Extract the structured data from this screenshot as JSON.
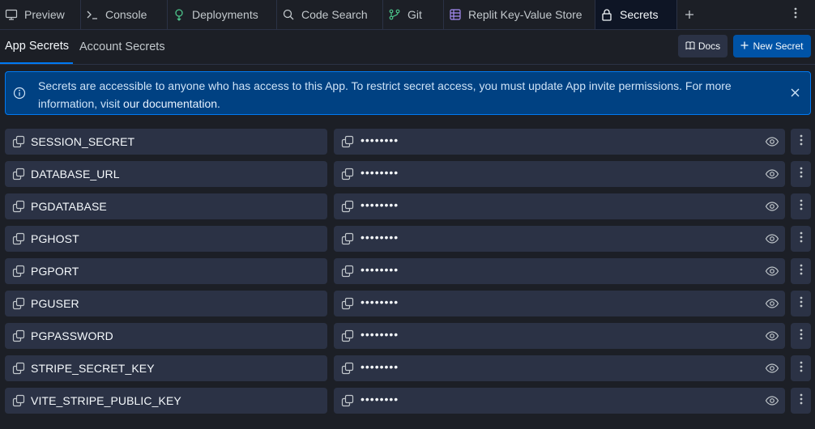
{
  "tabs": [
    {
      "label": "Preview",
      "icon": "monitor-icon"
    },
    {
      "label": "Console",
      "icon": "terminal-icon"
    },
    {
      "label": "Deployments",
      "icon": "deployments-icon"
    },
    {
      "label": "Code Search",
      "icon": "search-icon"
    },
    {
      "label": "Git",
      "icon": "git-icon"
    },
    {
      "label": "Replit Key-Value Store",
      "icon": "database-icon"
    },
    {
      "label": "Secrets",
      "icon": "lock-icon",
      "active": true
    }
  ],
  "subtabs": {
    "app_secrets": "App Secrets",
    "account_secrets": "Account Secrets"
  },
  "toolbar": {
    "docs_label": "Docs",
    "new_secret_label": "New Secret"
  },
  "banner": {
    "text": "Secrets are accessible to anyone who has access to this App. To restrict secret access, you must update App invite permissions. For more information, visit ",
    "link": "our documentation",
    "suffix": "."
  },
  "secrets": [
    {
      "key": "SESSION_SECRET",
      "value": "••••••••"
    },
    {
      "key": "DATABASE_URL",
      "value": "••••••••"
    },
    {
      "key": "PGDATABASE",
      "value": "••••••••"
    },
    {
      "key": "PGHOST",
      "value": "••••••••"
    },
    {
      "key": "PGPORT",
      "value": "••••••••"
    },
    {
      "key": "PGUSER",
      "value": "••••••••"
    },
    {
      "key": "PGPASSWORD",
      "value": "••••••••"
    },
    {
      "key": "STRIPE_SECRET_KEY",
      "value": "••••••••"
    },
    {
      "key": "VITE_STRIPE_PUBLIC_KEY",
      "value": "••••••••"
    }
  ],
  "colors": {
    "background": "#1c1f26",
    "surface": "#2b3245",
    "accent": "#0079f2",
    "banner_bg": "#004182",
    "primary_button": "#0053a6"
  }
}
